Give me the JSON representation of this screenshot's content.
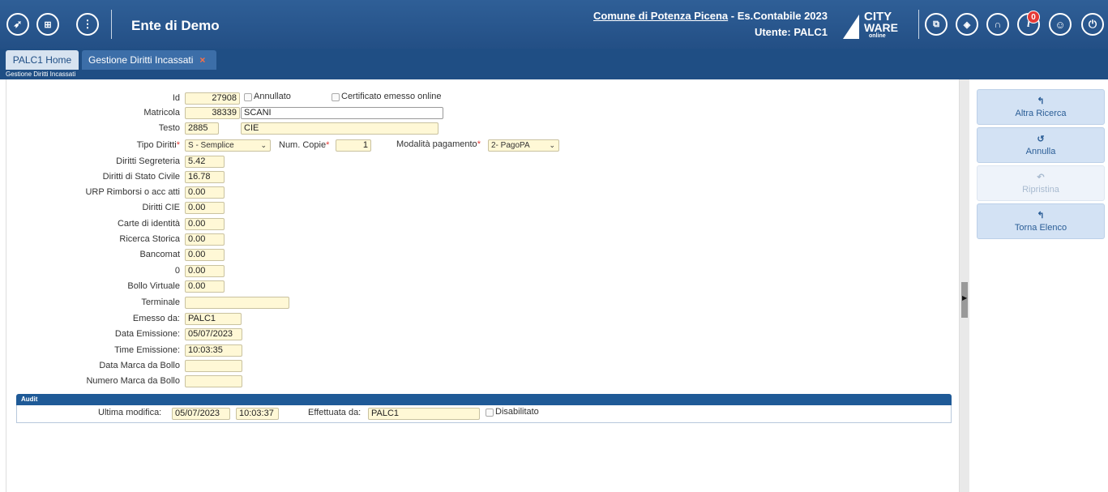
{
  "header": {
    "title": "Ente di Demo",
    "comune_link": "Comune di Potenza Picena",
    "esercizio": " - Es.Contabile 2023",
    "utente": "Utente: PALC1",
    "logo_line1": "CITY",
    "logo_line2": "WARE",
    "logo_line3": "online",
    "notification_count": "0",
    "left_icons": [
      "rocket-icon",
      "apps-grid-icon",
      "more-info-icon"
    ],
    "right_icons": [
      "windows-icon",
      "layers-icon",
      "headset-icon",
      "info-icon",
      "user-icon",
      "power-icon"
    ]
  },
  "tabs": [
    {
      "label": "PALC1 Home"
    },
    {
      "label": "Gestione Diritti Incassati",
      "close": "×"
    }
  ],
  "breadcrumb": "Gestione Diritti Incassati",
  "form": {
    "id": {
      "label": "Id",
      "value": "27908"
    },
    "annullato": "Annullato",
    "certificato": "Certificato emesso online",
    "matricola": {
      "label": "Matricola",
      "value": "38339",
      "name": "SCANI"
    },
    "testo": {
      "label": "Testo",
      "code": "2885",
      "value": "CIE"
    },
    "tipo_diritti": {
      "label": "Tipo Diritti",
      "value": "S - Semplice",
      "req": "*"
    },
    "num_copie": {
      "label": "Num. Copie",
      "value": "1",
      "req": "*"
    },
    "modalita": {
      "label": "Modalità pagamento",
      "value": "2- PagoPA",
      "req": "*"
    },
    "diritti_segreteria": {
      "label": "Diritti Segreteria",
      "value": "5.42"
    },
    "diritti_stato_civile": {
      "label": "Diritti di Stato Civile",
      "value": "16.78"
    },
    "urp": {
      "label": "URP Rimborsi o acc atti",
      "value": "0.00"
    },
    "diritti_cie": {
      "label": "Diritti CIE",
      "value": "0.00"
    },
    "carte_identita": {
      "label": "Carte di identità",
      "value": "0.00"
    },
    "ricerca_storica": {
      "label": "Ricerca Storica",
      "value": "0.00"
    },
    "bancomat": {
      "label": "Bancomat",
      "value": "0.00"
    },
    "zero": {
      "label": "0",
      "value": "0.00"
    },
    "bollo_virtuale": {
      "label": "Bollo Virtuale",
      "value": "0.00"
    },
    "terminale": {
      "label": "Terminale",
      "value": ""
    },
    "emesso_da": {
      "label": "Emesso da:",
      "value": "PALC1"
    },
    "data_emissione": {
      "label": "Data Emissione:",
      "value": "05/07/2023"
    },
    "time_emissione": {
      "label": "Time Emissione:",
      "value": "10:03:35"
    },
    "data_marca": {
      "label": "Data Marca da Bollo",
      "value": ""
    },
    "numero_marca": {
      "label": "Numero Marca da Bollo",
      "value": ""
    }
  },
  "audit": {
    "title": "Audit",
    "ultima_modifica_label": "Ultima modifica:",
    "data": "05/07/2023",
    "ora": "10:03:37",
    "effettuata_label": "Effettuata da:",
    "effettuata_value": "PALC1",
    "disabilitato": "Disabilitato"
  },
  "actions": [
    {
      "label": "Altra Ricerca",
      "icon": "back-arrow-icon",
      "glyph": "↰",
      "enabled": true
    },
    {
      "label": "Annulla",
      "icon": "undo-icon",
      "glyph": "↺",
      "enabled": true
    },
    {
      "label": "Ripristina",
      "icon": "restore-icon",
      "glyph": "↶",
      "enabled": false
    },
    {
      "label": "Torna Elenco",
      "icon": "back-arrow-icon",
      "glyph": "↰",
      "enabled": true
    }
  ]
}
